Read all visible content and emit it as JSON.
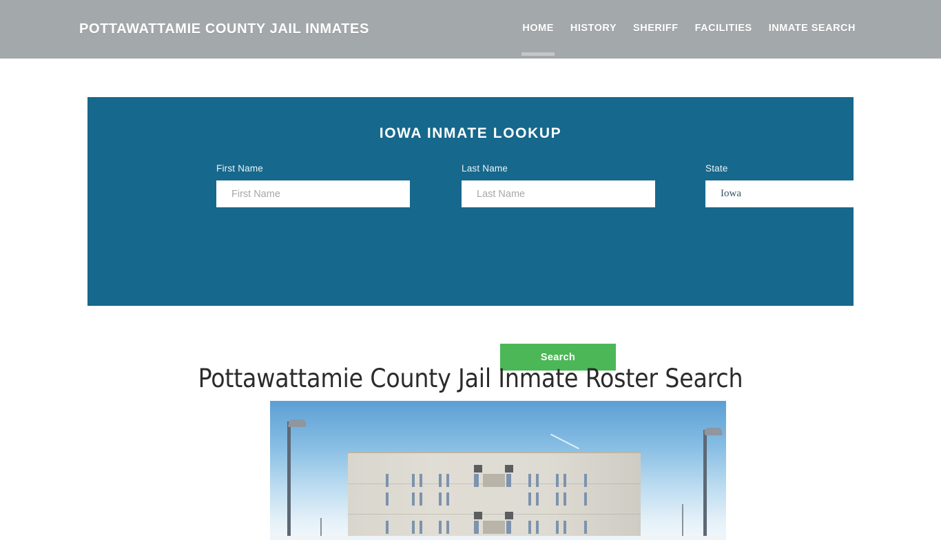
{
  "header": {
    "brand": "POTTAWATTAMIE COUNTY JAIL INMATES",
    "nav": [
      {
        "label": "HOME",
        "active": true
      },
      {
        "label": "HISTORY",
        "active": false
      },
      {
        "label": "SHERIFF",
        "active": false
      },
      {
        "label": "FACILITIES",
        "active": false
      },
      {
        "label": "INMATE SEARCH",
        "active": false
      }
    ],
    "background_color": "#a3a8ab",
    "active_indicator_color": "#c3c7c9"
  },
  "lookup": {
    "title": "IOWA INMATE LOOKUP",
    "panel_color": "#16688c",
    "fields": {
      "first": {
        "label": "First Name",
        "placeholder": "First Name",
        "value": ""
      },
      "last": {
        "label": "Last Name",
        "placeholder": "Last Name",
        "value": ""
      },
      "state": {
        "label": "State",
        "value": "Iowa",
        "options": [
          "Iowa"
        ]
      }
    },
    "search_button": {
      "label": "Search",
      "color": "#4cb757"
    }
  },
  "article": {
    "title": "Pottawattamie County Jail Inmate Roster Search",
    "image_alt": "Pottawattamie County Jail building exterior with light poles against a blue sky"
  }
}
